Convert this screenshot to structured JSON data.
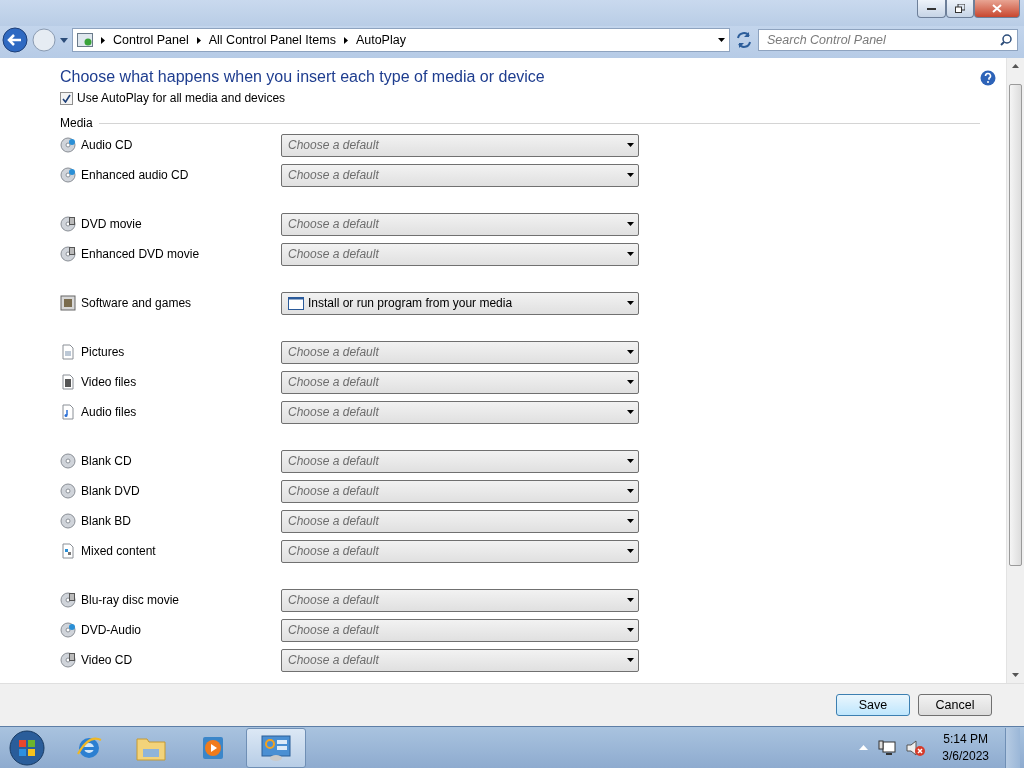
{
  "address_bar": {
    "breadcrumbs": [
      "Control Panel",
      "All Control Panel Items",
      "AutoPlay"
    ],
    "search": {
      "placeholder": "Search Control Panel"
    }
  },
  "heading": "Choose what happens when you insert each type of media or device",
  "use_autoplay": {
    "label": "Use AutoPlay for all media and devices",
    "checked": true
  },
  "section": "Media",
  "media_groups": [
    [
      {
        "label": "Audio CD",
        "kind": "musiccd",
        "dropdown": {
          "placeholder": "Choose a default"
        }
      },
      {
        "label": "Enhanced audio CD",
        "kind": "musiccd",
        "dropdown": {
          "placeholder": "Choose a default"
        }
      }
    ],
    [
      {
        "label": "DVD movie",
        "kind": "filmdisc",
        "dropdown": {
          "placeholder": "Choose a default"
        }
      },
      {
        "label": "Enhanced DVD movie",
        "kind": "filmdisc",
        "dropdown": {
          "placeholder": "Choose a default"
        }
      }
    ],
    [
      {
        "label": "Software and games",
        "kind": "software",
        "dropdown": {
          "value": "Install or run program from your media"
        }
      }
    ],
    [
      {
        "label": "Pictures",
        "kind": "picture",
        "dropdown": {
          "placeholder": "Choose a default"
        }
      },
      {
        "label": "Video files",
        "kind": "video",
        "dropdown": {
          "placeholder": "Choose a default"
        }
      },
      {
        "label": "Audio files",
        "kind": "audio",
        "dropdown": {
          "placeholder": "Choose a default"
        }
      }
    ],
    [
      {
        "label": "Blank CD",
        "kind": "blank",
        "dropdown": {
          "placeholder": "Choose a default"
        }
      },
      {
        "label": "Blank DVD",
        "kind": "blank",
        "dropdown": {
          "placeholder": "Choose a default"
        }
      },
      {
        "label": "Blank BD",
        "kind": "blank",
        "dropdown": {
          "placeholder": "Choose a default"
        }
      },
      {
        "label": "Mixed content",
        "kind": "mixed",
        "dropdown": {
          "placeholder": "Choose a default"
        }
      }
    ],
    [
      {
        "label": "Blu-ray disc movie",
        "kind": "filmdisc",
        "dropdown": {
          "placeholder": "Choose a default"
        }
      },
      {
        "label": "DVD-Audio",
        "kind": "musiccd",
        "dropdown": {
          "placeholder": "Choose a default"
        }
      },
      {
        "label": "Video CD",
        "kind": "filmdisc",
        "dropdown": {
          "placeholder": "Choose a default"
        }
      }
    ]
  ],
  "buttons": [
    {
      "label": "Save",
      "primary": true
    },
    {
      "label": "Cancel",
      "primary": false
    }
  ],
  "taskbar": {
    "apps": [
      {
        "kind": "browser",
        "selected": false
      },
      {
        "kind": "folder",
        "selected": false
      },
      {
        "kind": "player",
        "selected": false
      },
      {
        "kind": "panel",
        "selected": true
      }
    ],
    "time": "5:14 PM",
    "date": "3/6/2023"
  }
}
